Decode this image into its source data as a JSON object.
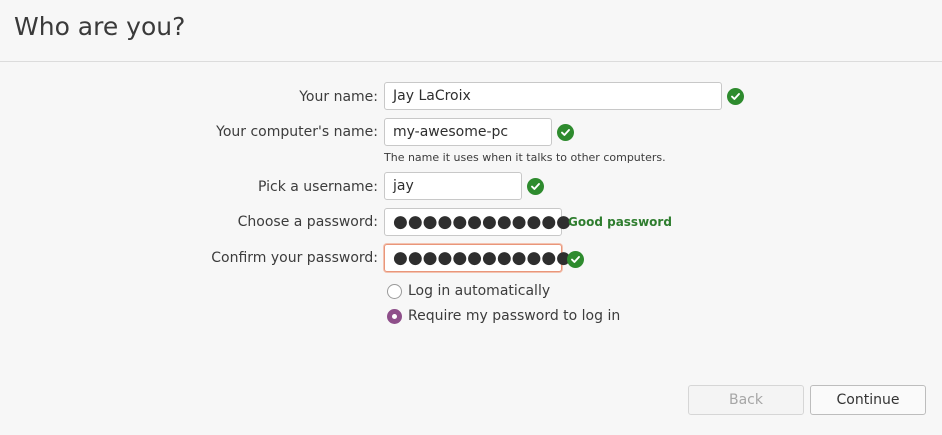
{
  "header": {
    "title": "Who are you?"
  },
  "form": {
    "name": {
      "label": "Your name:",
      "value": "Jay LaCroix"
    },
    "computer_name": {
      "label": "Your computer's name:",
      "value": "my-awesome-pc",
      "hint": "The name it uses when it talks to other computers."
    },
    "username": {
      "label": "Pick a username:",
      "value": "jay"
    },
    "password": {
      "label": "Choose a password:",
      "value": "●●●●●●●●●●●●",
      "strength": "Good password"
    },
    "confirm_password": {
      "label": "Confirm your password:",
      "value": "●●●●●●●●●●●●"
    },
    "login_options": [
      {
        "label": "Log in automatically",
        "selected": false
      },
      {
        "label": "Require my password to log in",
        "selected": true
      }
    ]
  },
  "buttons": {
    "back": "Back",
    "continue": "Continue"
  },
  "colors": {
    "check_green": "#2e8b2e",
    "strength_green": "#2e7d2e",
    "radio_selected": "#8e4f8a",
    "focus_border": "#e9967a"
  },
  "icons": {
    "valid": "check-circle-icon"
  }
}
